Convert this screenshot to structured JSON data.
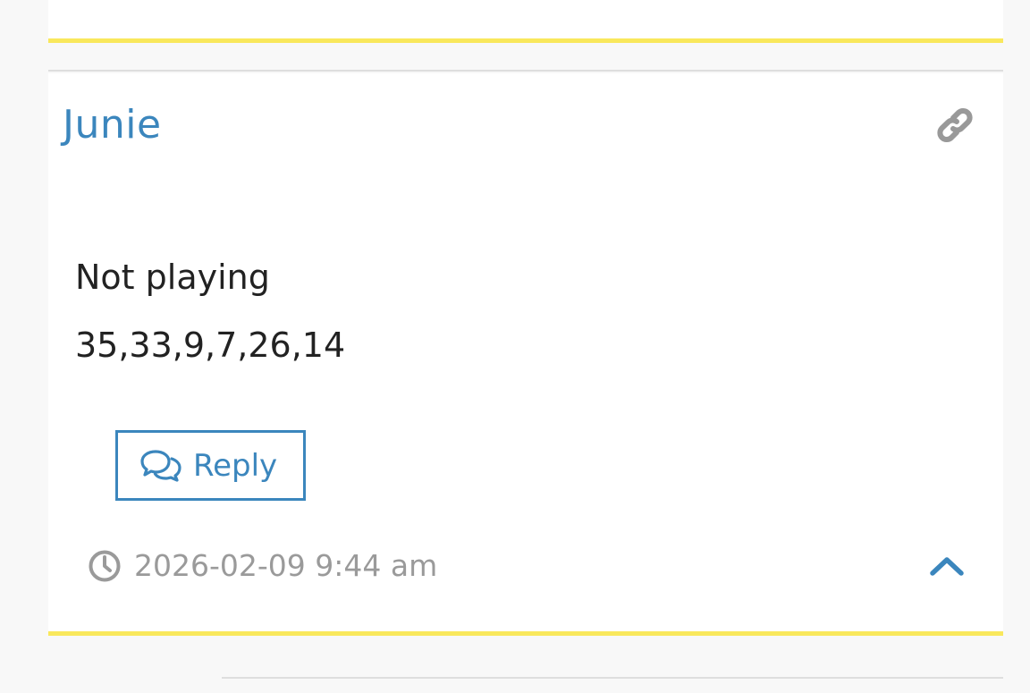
{
  "comment": {
    "author": "Junie",
    "lines": [
      "Not playing",
      "35,33,9,7,26,14"
    ],
    "reply_label": "Reply",
    "timestamp": "2026-02-09 9:44 am"
  },
  "icons": {
    "permalink": "link-icon",
    "reply": "speech-bubbles-icon",
    "time": "clock-icon",
    "collapse": "chevron-up-icon"
  },
  "colors": {
    "accent": "#3b86bd",
    "highlight": "#f9e85c",
    "muted": "#9a9a9a",
    "text": "#222222"
  }
}
